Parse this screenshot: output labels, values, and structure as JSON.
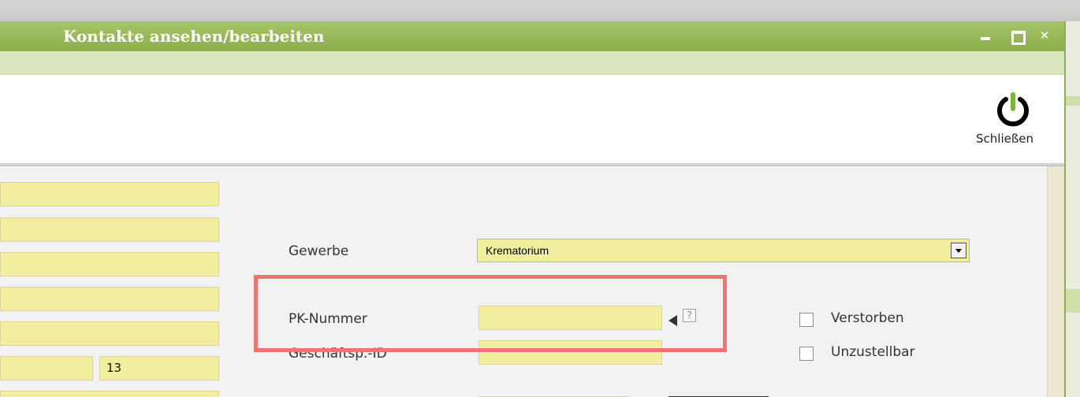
{
  "window": {
    "title": "Kontakte ansehen/bearbeiten",
    "controls": {
      "minimize": "minimize-icon",
      "maximize": "maximize-icon",
      "close": "close-icon"
    }
  },
  "toolbar": {
    "close_label": "Schließen",
    "close_icon": "power-icon"
  },
  "form": {
    "left_fields": [
      "",
      "",
      "",
      "",
      ""
    ],
    "house_number": "13",
    "gewerbe": {
      "label": "Gewerbe",
      "value": "Krematorium"
    },
    "pk_nummer": {
      "label": "PK-Nummer",
      "value": "",
      "help": "?"
    },
    "geschaeftsp_id": {
      "label": "Geschäftsp.-ID",
      "value": ""
    },
    "checkboxes": [
      {
        "label": "Verstorben",
        "checked": false
      },
      {
        "label": "Unzustellbar",
        "checked": false
      }
    ]
  },
  "colors": {
    "titlebar": "#8cae4a",
    "field_bg": "#f1ef9d",
    "highlight": "#f07476"
  }
}
